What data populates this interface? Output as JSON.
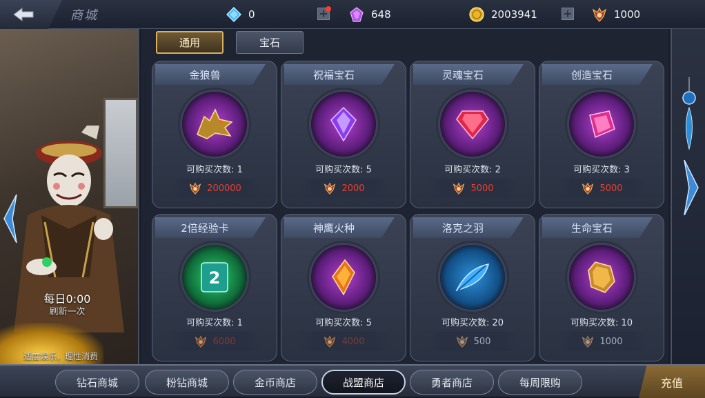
{
  "header": {
    "title": "商城",
    "diamond": "0",
    "pink_diamond": "648",
    "gold": "2003941",
    "medal": "1000"
  },
  "left_panel": {
    "refresh_time": "每日0:00",
    "refresh_label": "刷新一次",
    "notice": "适度娱乐，理性消费"
  },
  "tabs": [
    "通用",
    "宝石"
  ],
  "items": [
    {
      "name": "金狼兽",
      "count": "可购买次数: 1",
      "price": "200000"
    },
    {
      "name": "祝福宝石",
      "count": "可购买次数: 5",
      "price": "2000"
    },
    {
      "name": "灵魂宝石",
      "count": "可购买次数: 2",
      "price": "5000"
    },
    {
      "name": "创造宝石",
      "count": "可购买次数: 3",
      "price": "5000"
    },
    {
      "name": "2倍经验卡",
      "count": "可购买次数: 1",
      "price": "6000"
    },
    {
      "name": "神鹰火种",
      "count": "可购买次数: 5",
      "price": "4000"
    },
    {
      "name": "洛克之羽",
      "count": "可购买次数: 20",
      "price": "500"
    },
    {
      "name": "生命宝石",
      "count": "可购买次数: 10",
      "price": "1000"
    }
  ],
  "bottom_tabs": [
    "钻石商城",
    "粉钻商城",
    "金币商店",
    "战盟商店",
    "勇者商店",
    "每周限购"
  ],
  "recharge": "充值",
  "colors": {
    "price_red": "#e8402f",
    "price_gray": "#a6adbb",
    "active_tab": "#d9b15f"
  }
}
